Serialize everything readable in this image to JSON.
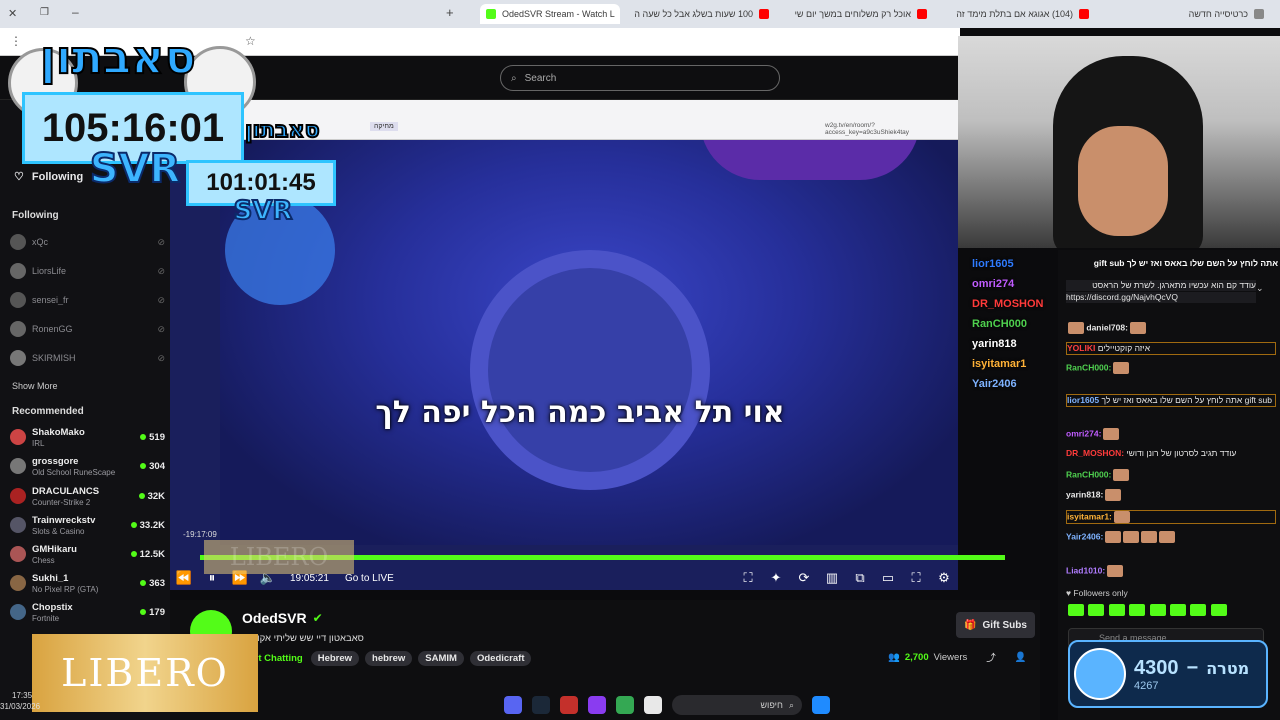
{
  "browser": {
    "tabs": [
      {
        "label": "OdedSVR Stream - Watch L",
        "active": true,
        "color": "#53fc18"
      },
      {
        "label": "100 שעות בשלג אבל כל שעה ה",
        "active": false,
        "color": "#ff0000"
      },
      {
        "label": "אוכל רק משלוחים במשך יום שי",
        "active": false,
        "color": "#ff0000"
      },
      {
        "label": "(104) אגוגא אם בתלת מימד זה",
        "active": false,
        "color": "#ff0000"
      },
      {
        "label": "כרטיסייה חדשה",
        "active": false,
        "color": "#888888"
      }
    ]
  },
  "header": {
    "search_placeholder": "Search"
  },
  "sidebar": {
    "following_heading": "Following",
    "following_tab": "Following",
    "following": [
      {
        "name": "xQc"
      },
      {
        "name": "LiorsLife"
      },
      {
        "name": "sensei_fr"
      },
      {
        "name": "RonenGG"
      },
      {
        "name": "SKIRMISH"
      }
    ],
    "show_more": "Show More",
    "recommended_heading": "Recommended",
    "recommended": [
      {
        "name": "ShakoMako",
        "category": "IRL",
        "viewers": "519",
        "color": "#c44"
      },
      {
        "name": "grossgore",
        "category": "Old School RuneScape",
        "viewers": "304",
        "color": "#777"
      },
      {
        "name": "DRACULANCS",
        "category": "Counter-Strike 2",
        "viewers": "32K",
        "color": "#a22"
      },
      {
        "name": "Trainwreckstv",
        "category": "Slots & Casino",
        "viewers": "33.2K",
        "color": "#556"
      },
      {
        "name": "GMHikaru",
        "category": "Chess",
        "viewers": "12.5K",
        "color": "#a55"
      },
      {
        "name": "Sukhi_1",
        "category": "No Pixel RP (GTA)",
        "viewers": "363",
        "color": "#864"
      },
      {
        "name": "Chopstix",
        "category": "Fortnite",
        "viewers": "179",
        "color": "#468"
      }
    ]
  },
  "overlay": {
    "logo_text": "סאבתון",
    "timer_main": "105:16:01",
    "timer_secondary": "101:01:45",
    "svr_label": "SVR",
    "ad_text": "LIBERO"
  },
  "video": {
    "subtitle": "אוי תל אביב כמה הכל יפה לך",
    "time_elapsed": "19:05:21",
    "go_live": "Go to LIVE",
    "inner_url": "w2g.tv/en/room/?access_key=a9c3uShiek4tay",
    "inner_tab": "מחיקה",
    "scrub_time": "-19:17:09",
    "progress": 1.0
  },
  "stream": {
    "channel_name": "OdedSVR",
    "title": "סאבאטון דיי שש שליתי אקונומי",
    "category": "Just Chatting",
    "tags": [
      "Hebrew",
      "hebrew",
      "SAMIM",
      "Odedicraft"
    ],
    "viewers": "2,700",
    "viewers_label": "Viewers",
    "gift_subs": "Gift Subs"
  },
  "chat_overlay": [
    {
      "user": "lior1605",
      "color": "#2f7bff"
    },
    {
      "user": "omri274",
      "color": "#c05cff"
    },
    {
      "user": "DR_MOSHON",
      "color": "#ff3b3b"
    },
    {
      "user": "RanCH000",
      "color": "#4fd04f"
    },
    {
      "user": "yarin818",
      "color": "#ffffff"
    },
    {
      "user": "isyitamar1",
      "color": "#ffb238"
    },
    {
      "user": "Yair2406",
      "color": "#7fb3ff"
    }
  ],
  "chat": {
    "pinned": "עודד קם הוא עכשיו מתארגן. לשרת של הראסט",
    "pinned_link": "https://discord.gg/NajvhQcVQ",
    "messages": [
      {
        "user": "daniel708:",
        "text": "",
        "color": "#e8e8e8"
      },
      {
        "user": "YOLIKI",
        "text": "איזה קוקטיילים",
        "color": "#ff4040"
      },
      {
        "user": "RanCH000:",
        "text": "",
        "color": "#4fd04f"
      },
      {
        "user": "lior1605",
        "text": "אתה לוחץ על השם שלו באאס ואז יש לך gift sub",
        "color": "#7fb3ff"
      },
      {
        "user": "omri274:",
        "text": "",
        "color": "#c05cff"
      },
      {
        "user": "DR_MOSHON:",
        "text": "עודד תגיב לסרטון של רונן ודושי",
        "color": "#ff3b3b"
      },
      {
        "user": "RanCH000:",
        "text": "",
        "color": "#4fd04f"
      },
      {
        "user": "yarin818:",
        "text": "",
        "color": "#e8e8e8"
      },
      {
        "user": "isyitamar1:",
        "text": "",
        "color": "#ffb238"
      },
      {
        "user": "Yair2406:",
        "text": "",
        "color": "#7fb3ff"
      },
      {
        "user": "Liad1010:",
        "text": "",
        "color": "#b07cff"
      }
    ],
    "followers_only": "Followers only",
    "input_placeholder": "Send a message",
    "top_gift": "אתה לוחץ על השם שלו באאס ואז יש לך gift sub"
  },
  "goal": {
    "value": "4300",
    "dash": "−",
    "label": "מטרה",
    "current": "4267"
  },
  "taskbar": {
    "search_label": "חיפוש",
    "clock_time": "17:35",
    "clock_date": "31/03/2026"
  }
}
